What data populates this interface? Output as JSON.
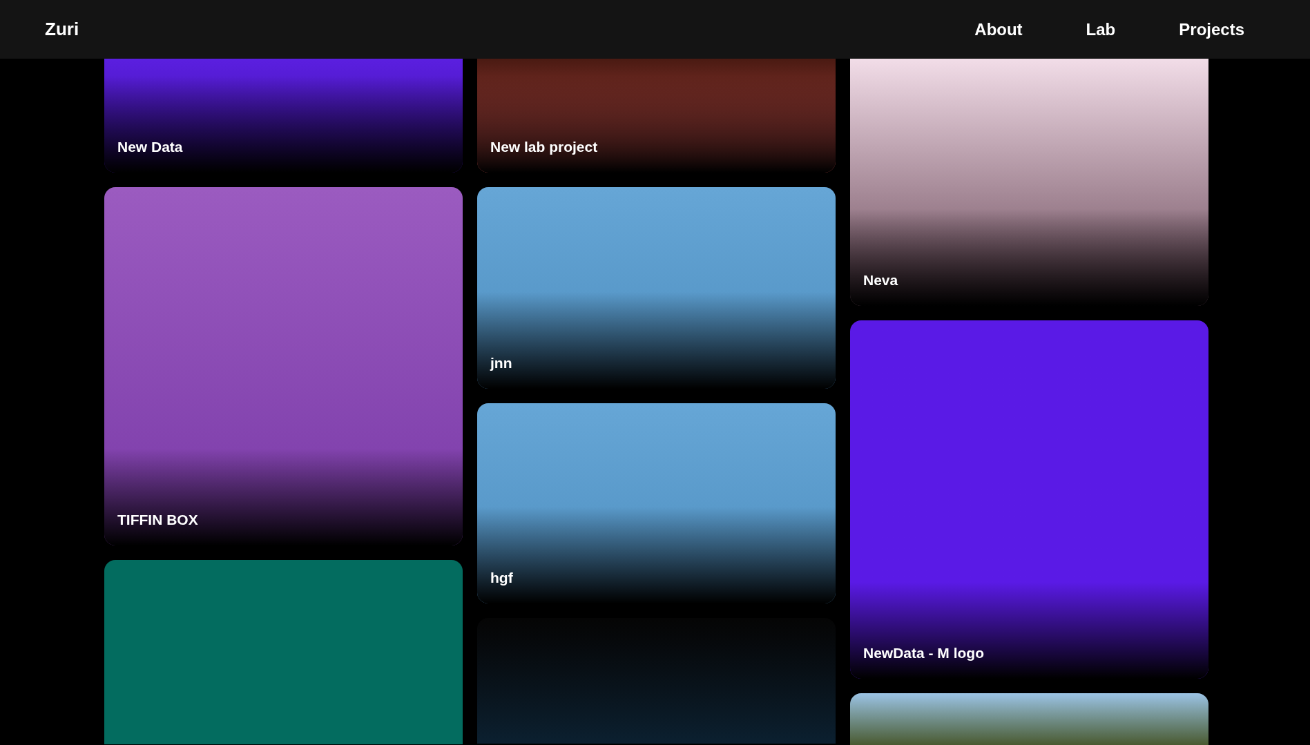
{
  "header": {
    "brand": "Zuri",
    "links": [
      {
        "label": "About"
      },
      {
        "label": "Lab"
      },
      {
        "label": "Projects"
      }
    ]
  },
  "columns": [
    {
      "cards": [
        {
          "kind": "captioned",
          "title": "New Data"
        },
        {
          "kind": "captioned",
          "title": "TIFFIN BOX"
        },
        {
          "kind": "image"
        }
      ]
    },
    {
      "cards": [
        {
          "kind": "captioned",
          "title": "New lab project"
        },
        {
          "kind": "captioned",
          "title": "jnn"
        },
        {
          "kind": "captioned",
          "title": "hgf"
        },
        {
          "kind": "image"
        }
      ]
    },
    {
      "cards": [
        {
          "kind": "captioned",
          "title": "Neva"
        },
        {
          "kind": "captioned",
          "title": "NewData - M logo"
        },
        {
          "kind": "image"
        }
      ]
    }
  ]
}
